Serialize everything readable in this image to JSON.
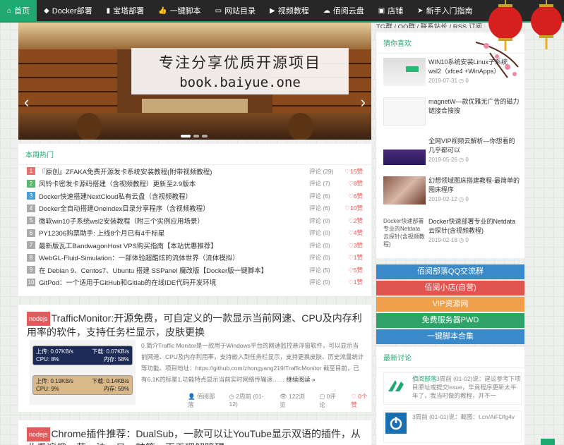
{
  "nav": {
    "items": [
      {
        "icon": "home-icon",
        "glyph": "⌂",
        "label": "首页"
      },
      {
        "icon": "cube-icon",
        "glyph": "◆",
        "label": "Docker部署"
      },
      {
        "icon": "bar-chart-icon",
        "glyph": "▮",
        "label": "宝塔部署"
      },
      {
        "icon": "thumbs-up-icon",
        "glyph": "👍",
        "label": "一键脚本"
      },
      {
        "icon": "folder-icon",
        "glyph": "▭",
        "label": "网站目录"
      },
      {
        "icon": "video-icon",
        "glyph": "▶",
        "label": "视频教程"
      },
      {
        "icon": "cloud-icon",
        "glyph": "☁",
        "label": "佰阅云盘"
      },
      {
        "icon": "shop-icon",
        "glyph": "▣",
        "label": "店铺"
      },
      {
        "icon": "send-icon",
        "glyph": "➤",
        "label": "新手入门指南"
      }
    ]
  },
  "banner": {
    "title": "专注分享优质开源项目",
    "domain": "book.baiyue.one"
  },
  "hot": {
    "heading": "本周热门",
    "rows": [
      {
        "n": "1",
        "color": "#e86f6f",
        "title": "『原创』ZFAKA免费开源发卡系统安装教程(附带视频教程)",
        "comments": "评论 (29)",
        "likes": "♡15赞"
      },
      {
        "n": "2",
        "color": "#56b76d",
        "title": "风铃卡密发卡源码搭建（含视频教程）更新至2.9版本",
        "comments": "评论 (7)",
        "likes": "♡8赞"
      },
      {
        "n": "3",
        "color": "#4a9ed6",
        "title": "Docker快速搭建NextCloud私有云盘（含视频教程）",
        "comments": "评论 (6)",
        "likes": "♡6赞"
      },
      {
        "n": "4",
        "color": "#aaaaaa",
        "title": "Docker全自动搭建Oneindex目录分享程序（含视频教程）",
        "comments": "评论 (6)",
        "likes": "♡10赞"
      },
      {
        "n": "5",
        "color": "#aaaaaa",
        "title": "微软win10子系统wsl2安装教程（附三个实例应用场景）",
        "comments": "评论 (0)",
        "likes": "♡2赞"
      },
      {
        "n": "6",
        "color": "#aaaaaa",
        "title": "PY12306购票助手: 上线8个月已有4千标星",
        "comments": "评论 (0)",
        "likes": "♡4赞"
      },
      {
        "n": "7",
        "color": "#aaaaaa",
        "title": "最新版瓦工BandwagonHost VPS购买指南【本站优惠推荐】",
        "comments": "评论 (0)",
        "likes": "♡3赞"
      },
      {
        "n": "8",
        "color": "#aaaaaa",
        "title": "WebGL-Fluid-Simulation：一部体验超酷炫的流体世界（流体模拟）",
        "comments": "评论 (0)",
        "likes": "♡1赞"
      },
      {
        "n": "9",
        "color": "#aaaaaa",
        "title": "在 Debian 9、Centos7、Ubuntu 搭建 SSPanel 魔改版【Docker版一键脚本】",
        "comments": "评论 (5)",
        "likes": "♡5赞"
      },
      {
        "n": "10",
        "color": "#aaaaaa",
        "title": "GitPod：一个适用于GitHub和Gitlab的在线IDE代码开发环境",
        "comments": "评论 (0)",
        "likes": "♡1赞"
      }
    ]
  },
  "post1": {
    "tag": "nodejs",
    "title": "TrafficMonitor:开源免费，可自定义的一款显示当前网速、CPU及内存利用率的软件，支持任务栏显示，皮肤更换",
    "monitor1": {
      "up": "上传: 0.07KB/s",
      "down": "下载: 0.07KB/s",
      "cpu": "CPU: 8%",
      "mem": "内存: 58%"
    },
    "monitor2": {
      "up": "上传: 0.19KB/s",
      "down": "下载: 0.14KB/s",
      "cpu": "CPU: 9%",
      "mem": "内存: 59%"
    },
    "excerpt": "0.简介Traffic Monitor是一款用于Windows平台的网速监控悬浮窗软件，可以显示当前网速、CPU及内存利用率，支持嵌入到任务栏显示，支持更换皮肤、历史流量统计等功能。项目地址：https://github.com/zhongyang219/TrafficMonitor 截至目前，已有6.1K的标星1.功能特点显示当前实时网络传输速……",
    "read_more": "继续阅读 »",
    "author": "👤 佰阅部落",
    "date": "◷ 2周前 (01-12)",
    "views": "👁 122浏览",
    "comments": "▢ 0评论",
    "likes": "♡ 0个赞"
  },
  "post2": {
    "tag": "nodejs",
    "title": "Chrome插件推荐：DualSub，一款可以让YouTube显示双语的插件，从此看遍俄、英、法、日、韩等，再无理解障碍"
  },
  "sidebar": {
    "top_text": "TG群 / QQ群 / 联系站长 / RSS 订阅",
    "guess_heading": "猜你喜欢",
    "guess": [
      {
        "title": "WIN10系统安装Linux子系统wsl2（xfce4 +WinApps）",
        "date": "2019-07-31 ◷ 0"
      },
      {
        "title": "magnetW—款优雅无广告的磁力链接合搜搜",
        "date": ""
      },
      {
        "title": "全网VIP视频云解析—你想看的几乎都可以",
        "date": "2019-05-26 ◷ 0"
      },
      {
        "title": "幻想领域图床搭建教程-最简单的图床程序",
        "date": "2019-02-12 ◷ 0"
      },
      {
        "title": "Docker快速部署专业的Netdata云探针(含视频教程)",
        "date": "2019-02-18 ◷ 0",
        "img_alt": "Docker快速部署专业的Netdata云探针(含视频教程)"
      }
    ],
    "buttons": [
      {
        "label": "佰阅部落QQ交流群",
        "color": "#3a8ac9"
      },
      {
        "label": "佰阅小店(自营)",
        "color": "#e0554f"
      },
      {
        "label": "VIP资源网",
        "color": "#f0a04b"
      },
      {
        "label": "免费服务器PWD",
        "color": "#2fa26a"
      },
      {
        "label": "一键脚本合集",
        "color": "#3a8ac9"
      }
    ],
    "comments_heading": "最新讨论",
    "comments": [
      {
        "author": "佰阅部落",
        "time": "3周前 (01-02)说：",
        "text": "建议参考下项目原址或提交issue，毕竟程序更新太半年了，我当时做的教程，并不一"
      },
      {
        "author": "",
        "time": "3周前 (01-01)说：",
        "text": "截图：t.cn/AiFDfg4v"
      }
    ]
  }
}
